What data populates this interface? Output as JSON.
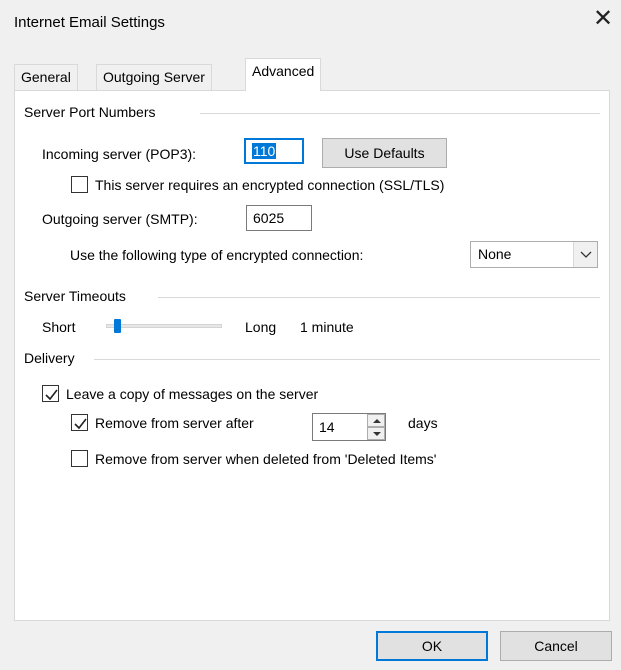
{
  "window": {
    "title": "Internet Email Settings",
    "close_glyph": "✕"
  },
  "tabs": [
    {
      "label": "General",
      "active": false
    },
    {
      "label": "Outgoing Server",
      "active": false
    },
    {
      "label": "Advanced",
      "active": true
    }
  ],
  "server_ports": {
    "heading": "Server Port Numbers",
    "incoming_label": "Incoming server (POP3):",
    "incoming_value": "110",
    "use_defaults_label": "Use Defaults",
    "ssl_checkbox_label": "This server requires an encrypted connection (SSL/TLS)",
    "ssl_checked": false,
    "outgoing_label": "Outgoing server (SMTP):",
    "outgoing_value": "6025",
    "encryption_label": "Use the following type of encrypted connection:",
    "encryption_value": "None"
  },
  "timeouts": {
    "heading": "Server Timeouts",
    "short_label": "Short",
    "long_label": "Long",
    "value_label": "1 minute",
    "slider_level": 0.1
  },
  "delivery": {
    "heading": "Delivery",
    "leave_copy_label": "Leave a copy of messages on the server",
    "leave_copy_checked": true,
    "remove_after_label": "Remove from server after",
    "remove_after_checked": true,
    "remove_after_days": "14",
    "days_label": "days",
    "remove_deleted_label": "Remove from server when deleted from 'Deleted Items'",
    "remove_deleted_checked": false
  },
  "footer": {
    "ok_label": "OK",
    "cancel_label": "Cancel"
  },
  "colors": {
    "accent": "#0078d7",
    "dialog_bg": "#f0f0f0",
    "panel_bg": "#ffffff"
  }
}
